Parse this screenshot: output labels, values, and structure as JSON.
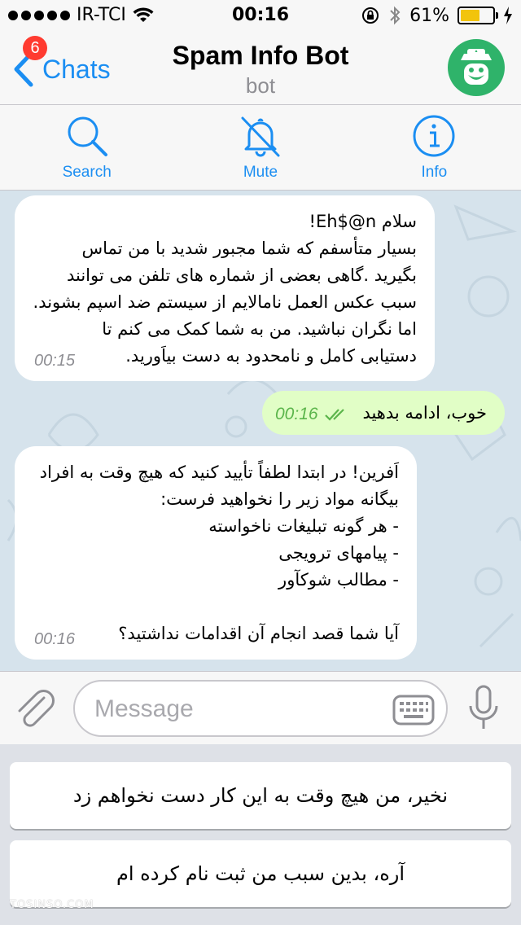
{
  "status_bar": {
    "carrier": "IR-TCI",
    "time": "00:16",
    "battery": "61%",
    "battery_level": 0.61
  },
  "nav": {
    "back_label": "Chats",
    "badge_count": "6",
    "title": "Spam Info Bot",
    "subtitle": "bot",
    "avatar_color": "#2fb36a"
  },
  "actions": [
    {
      "label": "Search",
      "icon": "search-icon"
    },
    {
      "label": "Mute",
      "icon": "bell-muted-icon"
    },
    {
      "label": "Info",
      "icon": "info-icon"
    }
  ],
  "messages": [
    {
      "direction": "incoming",
      "lines": [
        "سلام Eh$@n!",
        "بسیار متأسفم که شما مجبور شدید با من تماس",
        "بگیرید .گاهی بعضی از شماره های تلفن می توانند",
        "سبب عکس العمل نامالایم از سیستم ضد اسپم بشوند.",
        "اما نگران نباشید. من به شما کمک می کنم تا",
        "دستیابی کامل و نامحدود به دست بیاَورید."
      ],
      "time": "00:15"
    },
    {
      "direction": "outgoing",
      "text": "خوب، ادامه بدهید",
      "time": "00:16",
      "status": "read"
    },
    {
      "direction": "incoming",
      "lines": [
        "اَفرین! در ابتدا لطفاً تأیید کنید که هیچ وقت به افراد",
        "بیگانه مواد زیر را نخواهید فرست:",
        "- هر گونه تبلیغات ناخواسته",
        "- پیامهای ترویجی",
        "- مطالب شوکآور",
        "",
        "آیا شما قصد انجام آن اقدامات نداشتید؟"
      ],
      "time": "00:16"
    }
  ],
  "input": {
    "placeholder": "Message"
  },
  "replies": [
    "نخیر، من هیچ وقت به این کار دست نخواهم زد",
    "آره، بدین سبب من ثبت نام کرده ام"
  ],
  "watermark": "TOSINSO.COM"
}
